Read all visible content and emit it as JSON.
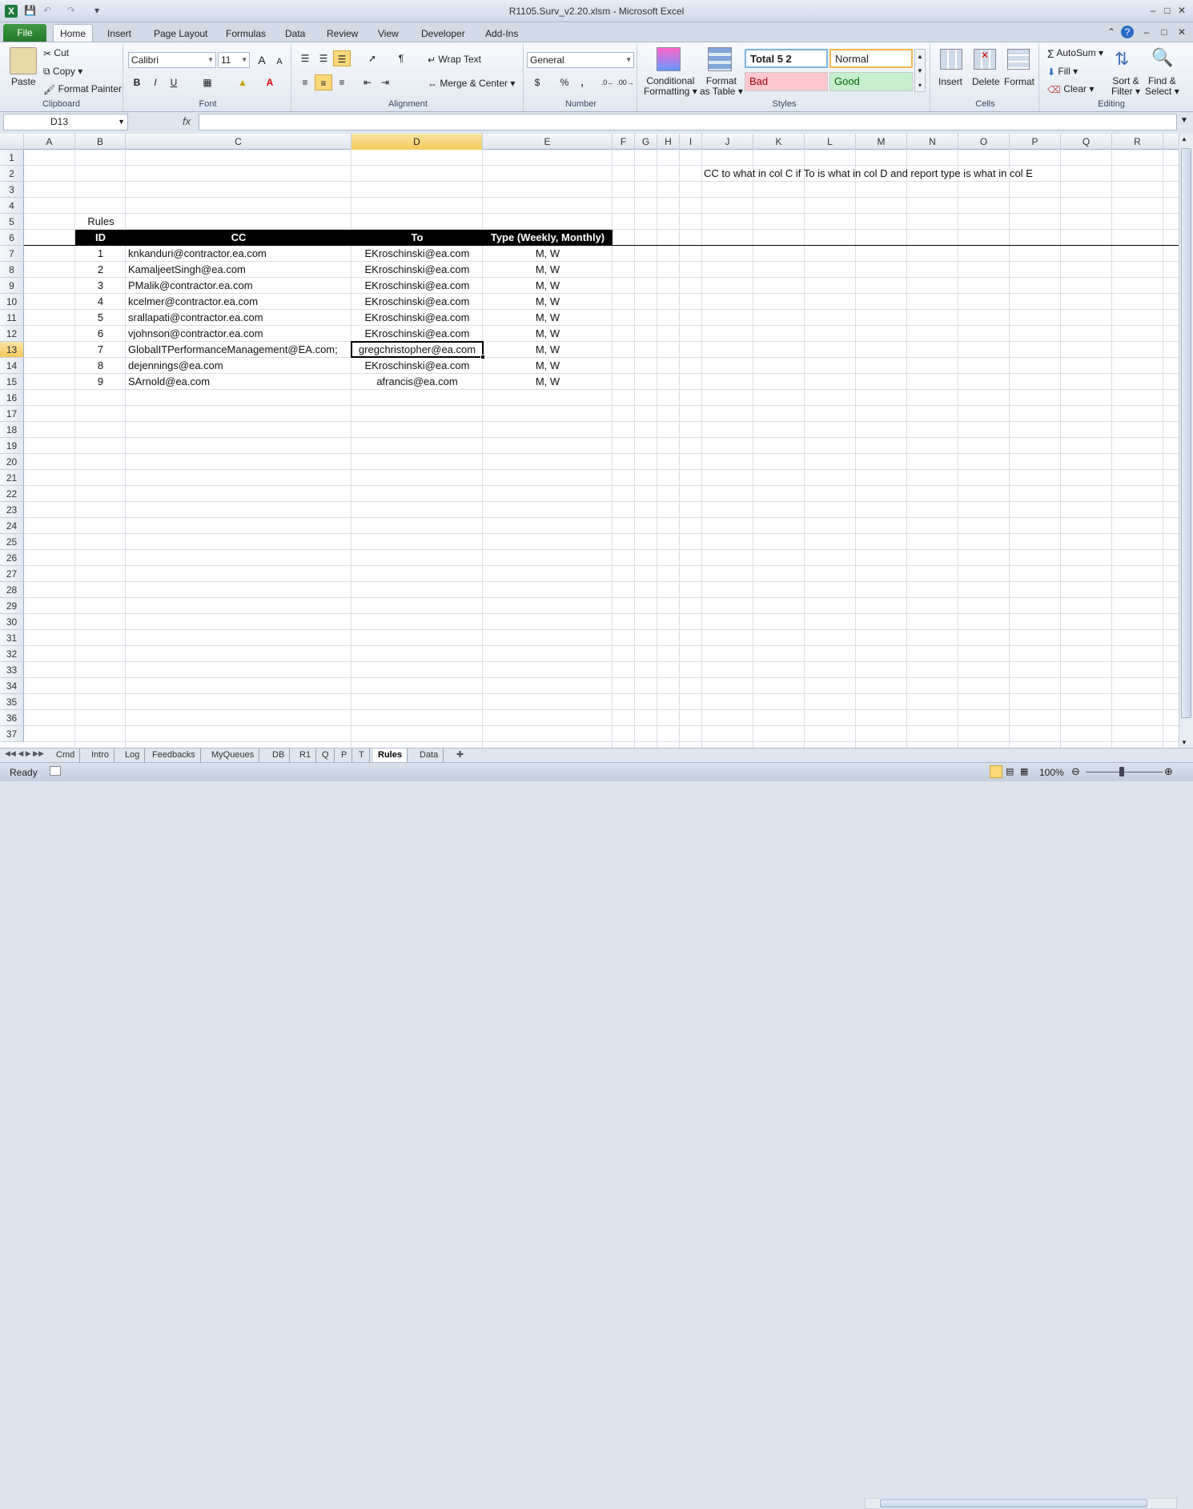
{
  "window": {
    "title": "R1105.Surv_v2.20.xlsm  -  Microsoft Excel",
    "app_icon": "X"
  },
  "ribbon_tabs": [
    "File",
    "Home",
    "Insert",
    "Page Layout",
    "Formulas",
    "Data",
    "Review",
    "View",
    "Developer",
    "Add-Ins"
  ],
  "active_tab": "Home",
  "clipboard": {
    "paste": "Paste",
    "cut": "Cut",
    "copy": "Copy",
    "format_painter": "Format Painter",
    "label": "Clipboard"
  },
  "font": {
    "name": "Calibri",
    "size": "11",
    "label": "Font",
    "bold": "B",
    "italic": "I",
    "underline": "U",
    "grow": "A",
    "shrink": "A"
  },
  "alignment": {
    "wrap": "Wrap Text",
    "merge": "Merge & Center",
    "label": "Alignment"
  },
  "number": {
    "format": "General",
    "label": "Number",
    "currency": "$",
    "percent": "%",
    "comma": ","
  },
  "styles": {
    "conditional": "Conditional",
    "conditional2": "Formatting",
    "format_table": "Format",
    "format_table2": "as Table",
    "label": "Styles",
    "total": "Total 5 2",
    "normal": "Normal",
    "bad": "Bad",
    "good": "Good"
  },
  "cells": {
    "insert": "Insert",
    "delete": "Delete",
    "format": "Format",
    "label": "Cells"
  },
  "editing": {
    "autosum": "AutoSum",
    "fill": "Fill",
    "clear": "Clear",
    "sort": "Sort &",
    "sort2": "Filter",
    "find": "Find &",
    "find2": "Select",
    "label": "Editing"
  },
  "formula_bar": {
    "name_box": "D13",
    "fx": "fx",
    "content": ""
  },
  "columns": [
    "A",
    "B",
    "C",
    "D",
    "E",
    "F",
    "G",
    "H",
    "I",
    "J",
    "K",
    "L",
    "M",
    "N",
    "O",
    "P",
    "Q",
    "R"
  ],
  "selected_column": "D",
  "selected_row": "13",
  "rows": [
    "1",
    "2",
    "3",
    "4",
    "5",
    "6",
    "7",
    "8",
    "9",
    "10",
    "11",
    "12",
    "13",
    "14",
    "15",
    "16",
    "17",
    "18",
    "19",
    "20",
    "21",
    "22",
    "23",
    "24",
    "25",
    "26",
    "27",
    "28",
    "29",
    "30",
    "31",
    "32",
    "33",
    "34",
    "35",
    "36",
    "37"
  ],
  "note": "CC to what in col C if To is what in col D and report type is what in col E",
  "table": {
    "caption": "Rules",
    "headers": [
      "ID",
      "CC",
      "To",
      "Type (Weekly, Monthly)"
    ],
    "rows": [
      [
        "1",
        "knkanduri@contractor.ea.com",
        "EKroschinski@ea.com",
        "M, W"
      ],
      [
        "2",
        "KamaljeetSingh@ea.com",
        "EKroschinski@ea.com",
        "M, W"
      ],
      [
        "3",
        "PMalik@contractor.ea.com",
        "EKroschinski@ea.com",
        "M, W"
      ],
      [
        "4",
        "kcelmer@contractor.ea.com",
        "EKroschinski@ea.com",
        "M, W"
      ],
      [
        "5",
        "srallapati@contractor.ea.com",
        "EKroschinski@ea.com",
        "M, W"
      ],
      [
        "6",
        "vjohnson@contractor.ea.com",
        "EKroschinski@ea.com",
        "M, W"
      ],
      [
        "7",
        "GlobalITPerformanceManagement@EA.com;",
        "gregchristopher@ea.com",
        "M, W"
      ],
      [
        "8",
        "dejennings@ea.com",
        "EKroschinski@ea.com",
        "M, W"
      ],
      [
        "9",
        "SArnold@ea.com",
        "afrancis@ea.com",
        "M, W"
      ]
    ]
  },
  "sheet_tabs": [
    "Cmd",
    "Intro",
    "Log",
    "Feedbacks",
    "MyQueues",
    "DB",
    "R1",
    "Q",
    "P",
    "T",
    "Rules",
    "Data"
  ],
  "active_sheet": "Rules",
  "status": {
    "ready": "Ready",
    "zoom": "100%"
  }
}
